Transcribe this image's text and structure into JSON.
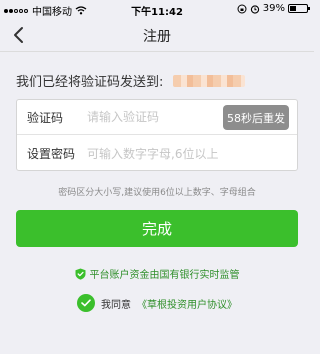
{
  "status_bar": {
    "carrier": "中国移动",
    "time": "下午11:42",
    "battery": "39%",
    "battery_level": 0.39,
    "signal_bars_filled": 2,
    "signal_bars_total": 5
  },
  "nav": {
    "title": "注册",
    "back_icon": "chevron-left-icon"
  },
  "sent_notice": {
    "label": "我们已经将验证码发送到:"
  },
  "form": {
    "code_label": "验证码",
    "code_placeholder": "请输入验证码",
    "code_value": "",
    "resend_label": "58秒后重发",
    "password_label": "设置密码",
    "password_placeholder": "可输入数字字母,6位以上",
    "password_value": ""
  },
  "hint": "密码区分大小写,建议使用6位以上数字、字母组合",
  "done_label": "完成",
  "supervise_text": "平台账户资金由国有银行实时监管",
  "agreement": {
    "prefix": "我同意",
    "link": "《草根投资用户协议》",
    "checked": true
  },
  "colors": {
    "accent": "#3bbf2c",
    "accent_text": "#2f8f2a",
    "background": "#efeff4",
    "resend_bg": "#8d8d8d"
  }
}
